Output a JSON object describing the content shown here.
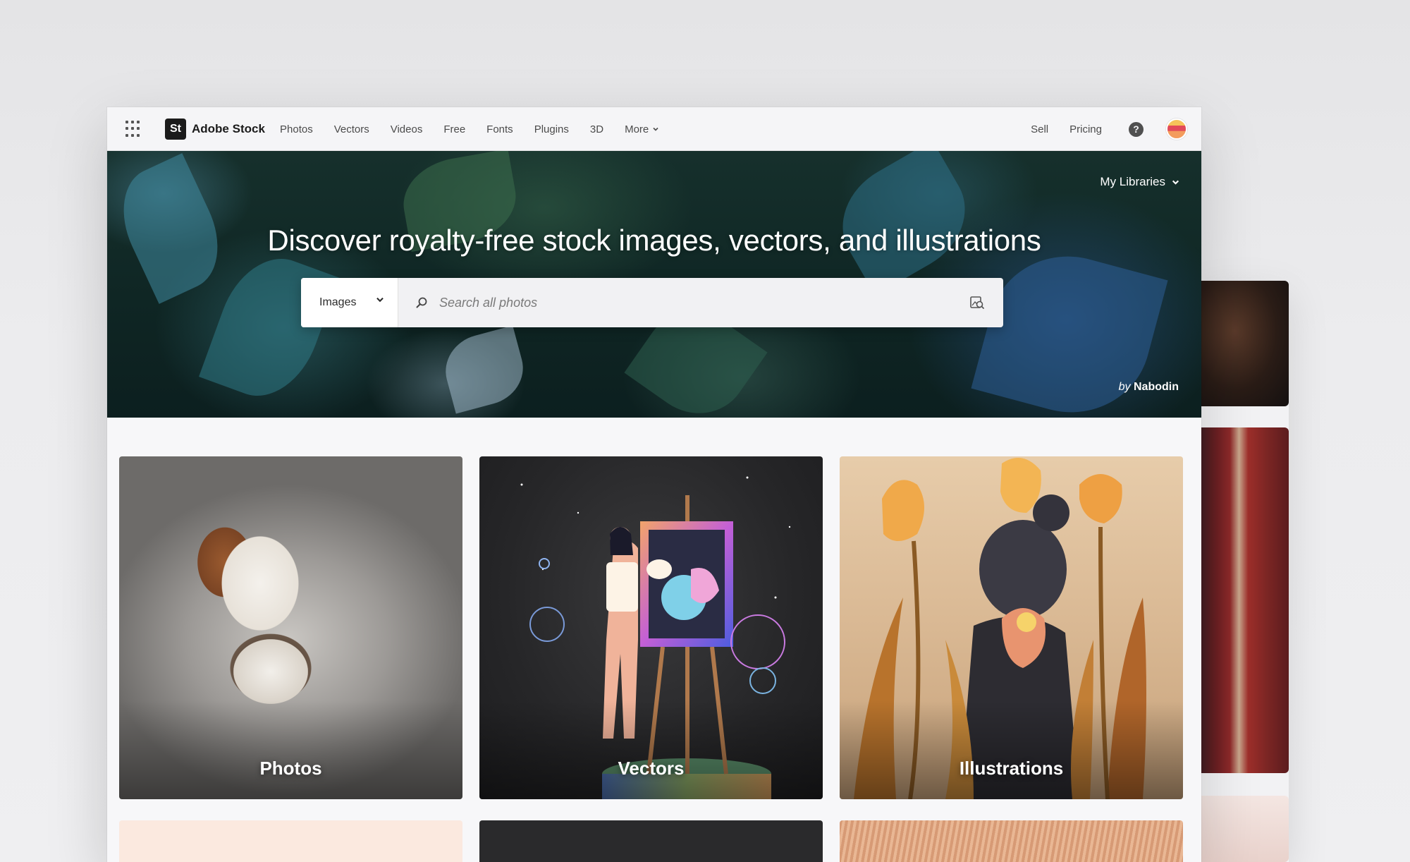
{
  "app": {
    "brand_mark": "St",
    "brand_name": "Adobe Stock"
  },
  "nav": {
    "items": [
      {
        "label": "Photos"
      },
      {
        "label": "Vectors"
      },
      {
        "label": "Videos"
      },
      {
        "label": "Free"
      },
      {
        "label": "Fonts"
      },
      {
        "label": "Plugins"
      },
      {
        "label": "3D"
      },
      {
        "label": "More"
      }
    ],
    "right": [
      {
        "label": "Sell"
      },
      {
        "label": "Pricing"
      }
    ],
    "help_symbol": "?",
    "icons": {
      "apps": "apps-grid-icon",
      "help": "help-icon",
      "avatar": "avatar"
    }
  },
  "hero": {
    "title": "Discover royalty-free stock images, vectors, and illustrations",
    "libraries_label": "My Libraries",
    "search": {
      "type_selected": "Images",
      "placeholder": "Search all photos",
      "value": ""
    },
    "credit_prefix": "by",
    "credit_name": "Nabodin"
  },
  "categories": [
    {
      "label": "Photos"
    },
    {
      "label": "Vectors"
    },
    {
      "label": "Illustrations"
    }
  ],
  "colors": {
    "accent_dark": "#1b1b1b",
    "hero_bg": "#0f2624"
  }
}
